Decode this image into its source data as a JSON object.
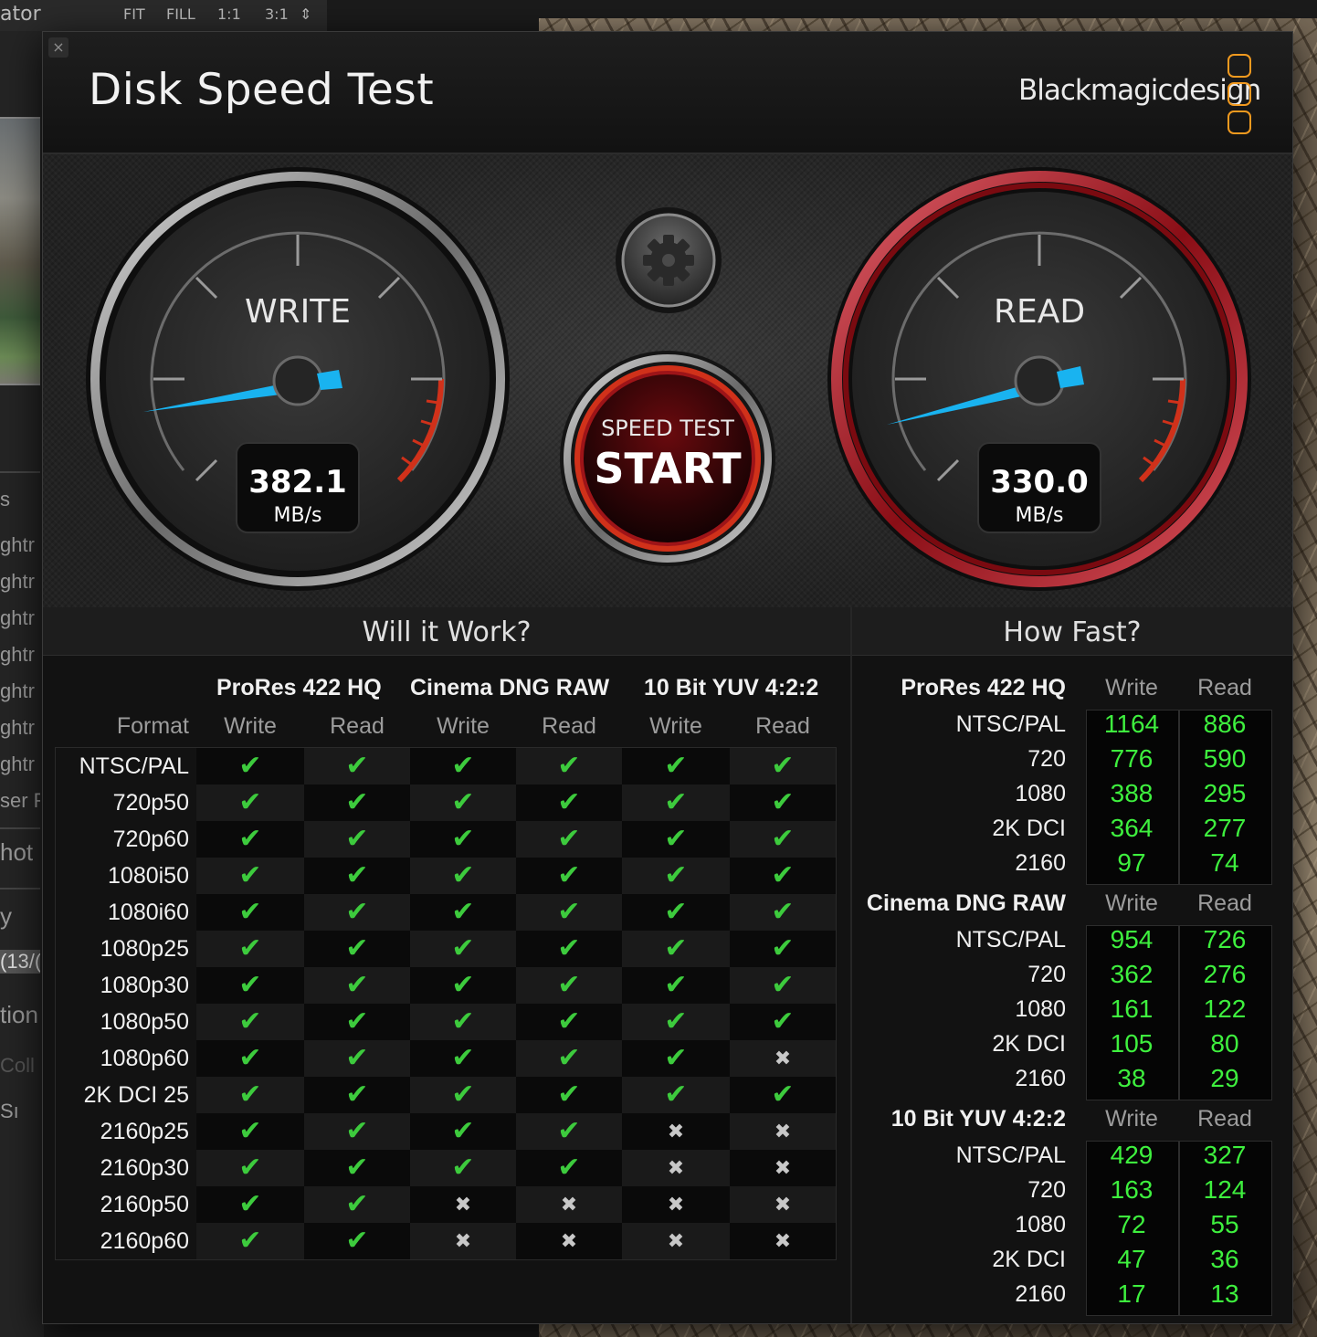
{
  "background": {
    "toolbar_items": [
      "ator",
      "FIT",
      "FILL",
      "1:1",
      "3:1",
      "⇕"
    ],
    "sidebar_fragments": [
      "s",
      "ghtr",
      "ghtr",
      "ghtr",
      "ghtr",
      "ghtr",
      "ghtr",
      "ghtr",
      "ser F",
      "hot",
      "y",
      "(13/(",
      "tion",
      "Coll",
      "Sı"
    ]
  },
  "window": {
    "close_label": "×",
    "title": "Disk Speed Test",
    "brand": "Blackmagicdesign"
  },
  "gauges": {
    "write": {
      "label": "WRITE",
      "value": "382.1",
      "unit": "MB/s"
    },
    "read": {
      "label": "READ",
      "value": "330.0",
      "unit": "MB/s"
    },
    "start_button": {
      "line1": "SPEED TEST",
      "line2": "START"
    },
    "settings_icon": "gear-icon"
  },
  "will_it_work": {
    "title": "Will it Work?",
    "format_header": "Format",
    "groups": [
      "ProRes 422 HQ",
      "Cinema DNG RAW",
      "10 Bit YUV 4:2:2"
    ],
    "sub_headers": [
      "Write",
      "Read",
      "Write",
      "Read",
      "Write",
      "Read"
    ],
    "check_symbol": "✔",
    "cross_symbol": "✖",
    "rows": [
      {
        "format": "NTSC/PAL",
        "results": [
          1,
          1,
          1,
          1,
          1,
          1
        ]
      },
      {
        "format": "720p50",
        "results": [
          1,
          1,
          1,
          1,
          1,
          1
        ]
      },
      {
        "format": "720p60",
        "results": [
          1,
          1,
          1,
          1,
          1,
          1
        ]
      },
      {
        "format": "1080i50",
        "results": [
          1,
          1,
          1,
          1,
          1,
          1
        ]
      },
      {
        "format": "1080i60",
        "results": [
          1,
          1,
          1,
          1,
          1,
          1
        ]
      },
      {
        "format": "1080p25",
        "results": [
          1,
          1,
          1,
          1,
          1,
          1
        ]
      },
      {
        "format": "1080p30",
        "results": [
          1,
          1,
          1,
          1,
          1,
          1
        ]
      },
      {
        "format": "1080p50",
        "results": [
          1,
          1,
          1,
          1,
          1,
          1
        ]
      },
      {
        "format": "1080p60",
        "results": [
          1,
          1,
          1,
          1,
          1,
          0
        ]
      },
      {
        "format": "2K DCI 25",
        "results": [
          1,
          1,
          1,
          1,
          1,
          1
        ]
      },
      {
        "format": "2160p25",
        "results": [
          1,
          1,
          1,
          1,
          0,
          0
        ]
      },
      {
        "format": "2160p30",
        "results": [
          1,
          1,
          1,
          1,
          0,
          0
        ]
      },
      {
        "format": "2160p50",
        "results": [
          1,
          1,
          0,
          0,
          0,
          0
        ]
      },
      {
        "format": "2160p60",
        "results": [
          1,
          1,
          0,
          0,
          0,
          0
        ]
      }
    ]
  },
  "how_fast": {
    "title": "How Fast?",
    "col_write": "Write",
    "col_read": "Read",
    "groups": [
      {
        "name": "ProRes 422 HQ",
        "rows": [
          {
            "format": "NTSC/PAL",
            "write": "1164",
            "read": "886"
          },
          {
            "format": "720",
            "write": "776",
            "read": "590"
          },
          {
            "format": "1080",
            "write": "388",
            "read": "295"
          },
          {
            "format": "2K DCI",
            "write": "364",
            "read": "277"
          },
          {
            "format": "2160",
            "write": "97",
            "read": "74"
          }
        ]
      },
      {
        "name": "Cinema DNG RAW",
        "rows": [
          {
            "format": "NTSC/PAL",
            "write": "954",
            "read": "726"
          },
          {
            "format": "720",
            "write": "362",
            "read": "276"
          },
          {
            "format": "1080",
            "write": "161",
            "read": "122"
          },
          {
            "format": "2K DCI",
            "write": "105",
            "read": "80"
          },
          {
            "format": "2160",
            "write": "38",
            "read": "29"
          }
        ]
      },
      {
        "name": "10 Bit YUV 4:2:2",
        "rows": [
          {
            "format": "NTSC/PAL",
            "write": "429",
            "read": "327"
          },
          {
            "format": "720",
            "write": "163",
            "read": "124"
          },
          {
            "format": "1080",
            "write": "72",
            "read": "55"
          },
          {
            "format": "2K DCI",
            "write": "47",
            "read": "36"
          },
          {
            "format": "2160",
            "write": "17",
            "read": "13"
          }
        ]
      }
    ]
  },
  "colors": {
    "accent_orange": "#f29a1f",
    "needle_blue": "#19b3f0",
    "ok_green": "#3dcb3d",
    "value_green": "#3ef03e",
    "read_red": "#b3121c"
  }
}
